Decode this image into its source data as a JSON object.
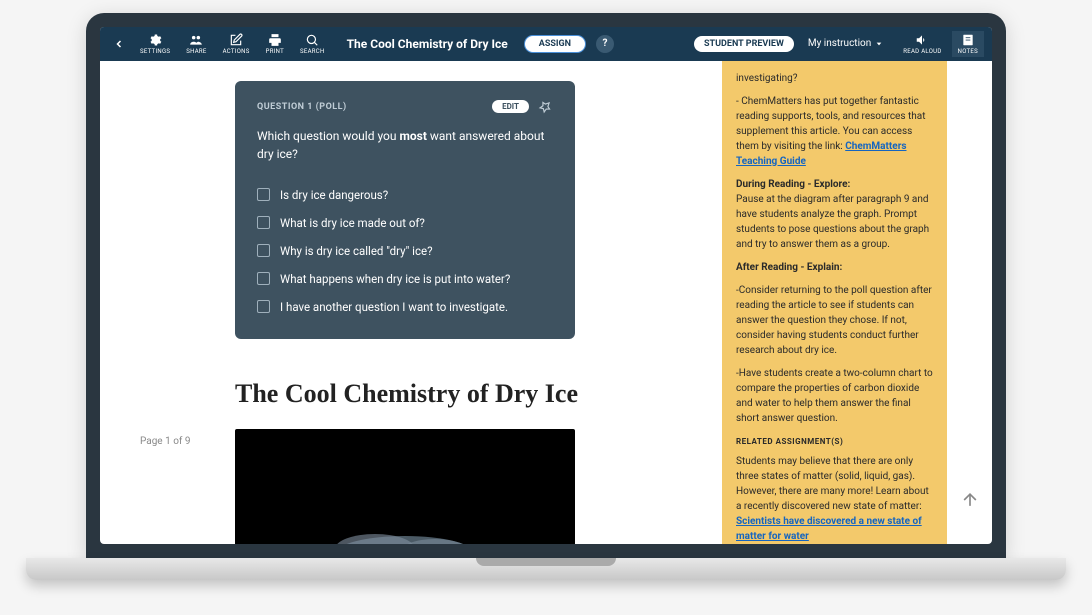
{
  "nav": {
    "settings": "SETTINGS",
    "share": "SHARE",
    "actions": "ACTIONS",
    "print": "PRINT",
    "search": "SEARCH",
    "title": "The Cool Chemistry of Dry Ice",
    "assign": "ASSIGN",
    "preview": "STUDENT PREVIEW",
    "dropdown": "My instruction",
    "readaloud": "READ ALOUD",
    "notes": "NOTES"
  },
  "question": {
    "label": "QUESTION 1 (POLL)",
    "edit": "EDIT",
    "text_pre": "Which question would you ",
    "text_strong": "most",
    "text_post": " want answered about dry ice?",
    "options": [
      "Is dry ice dangerous?",
      "What is dry ice made out of?",
      "Why is dry ice called \"dry\" ice?",
      "What happens when dry ice is put into water?",
      "I have another question I want to investigate."
    ]
  },
  "page_indicator": "Page 1 of 9",
  "article_title": "The Cool Chemistry of Dry Ice",
  "sidebar": {
    "intro_tail": "investigating?",
    "chemmatters_pre": "- ChemMatters has put together fantastic reading supports, tools, and resources that supplement this article. You can access them by visiting the link: ",
    "chemmatters_link": "ChemMatters Teaching Guide",
    "during_title": "During Reading - Explore:",
    "during_body": "Pause at the diagram after paragraph 9 and have students analyze the graph. Prompt students to pose questions about the graph and try to answer them as a group.",
    "after_title": "After Reading - Explain:",
    "after_body1": "-Consider returning to the poll question after reading the article to see if students can answer the question they chose. If not, consider having students conduct further research about dry ice.",
    "after_body2": "-Have students create a two-column chart to compare the properties of carbon dioxide and water to help them answer the final short answer question.",
    "related_label": "RELATED ASSIGNMENT(S)",
    "related_body": "Students may believe that there are only three states of matter (solid, liquid, gas). However, there are many more! Learn about a recently discovered new state of matter:",
    "related_link": "Scientists have discovered a new state of matter for water"
  }
}
